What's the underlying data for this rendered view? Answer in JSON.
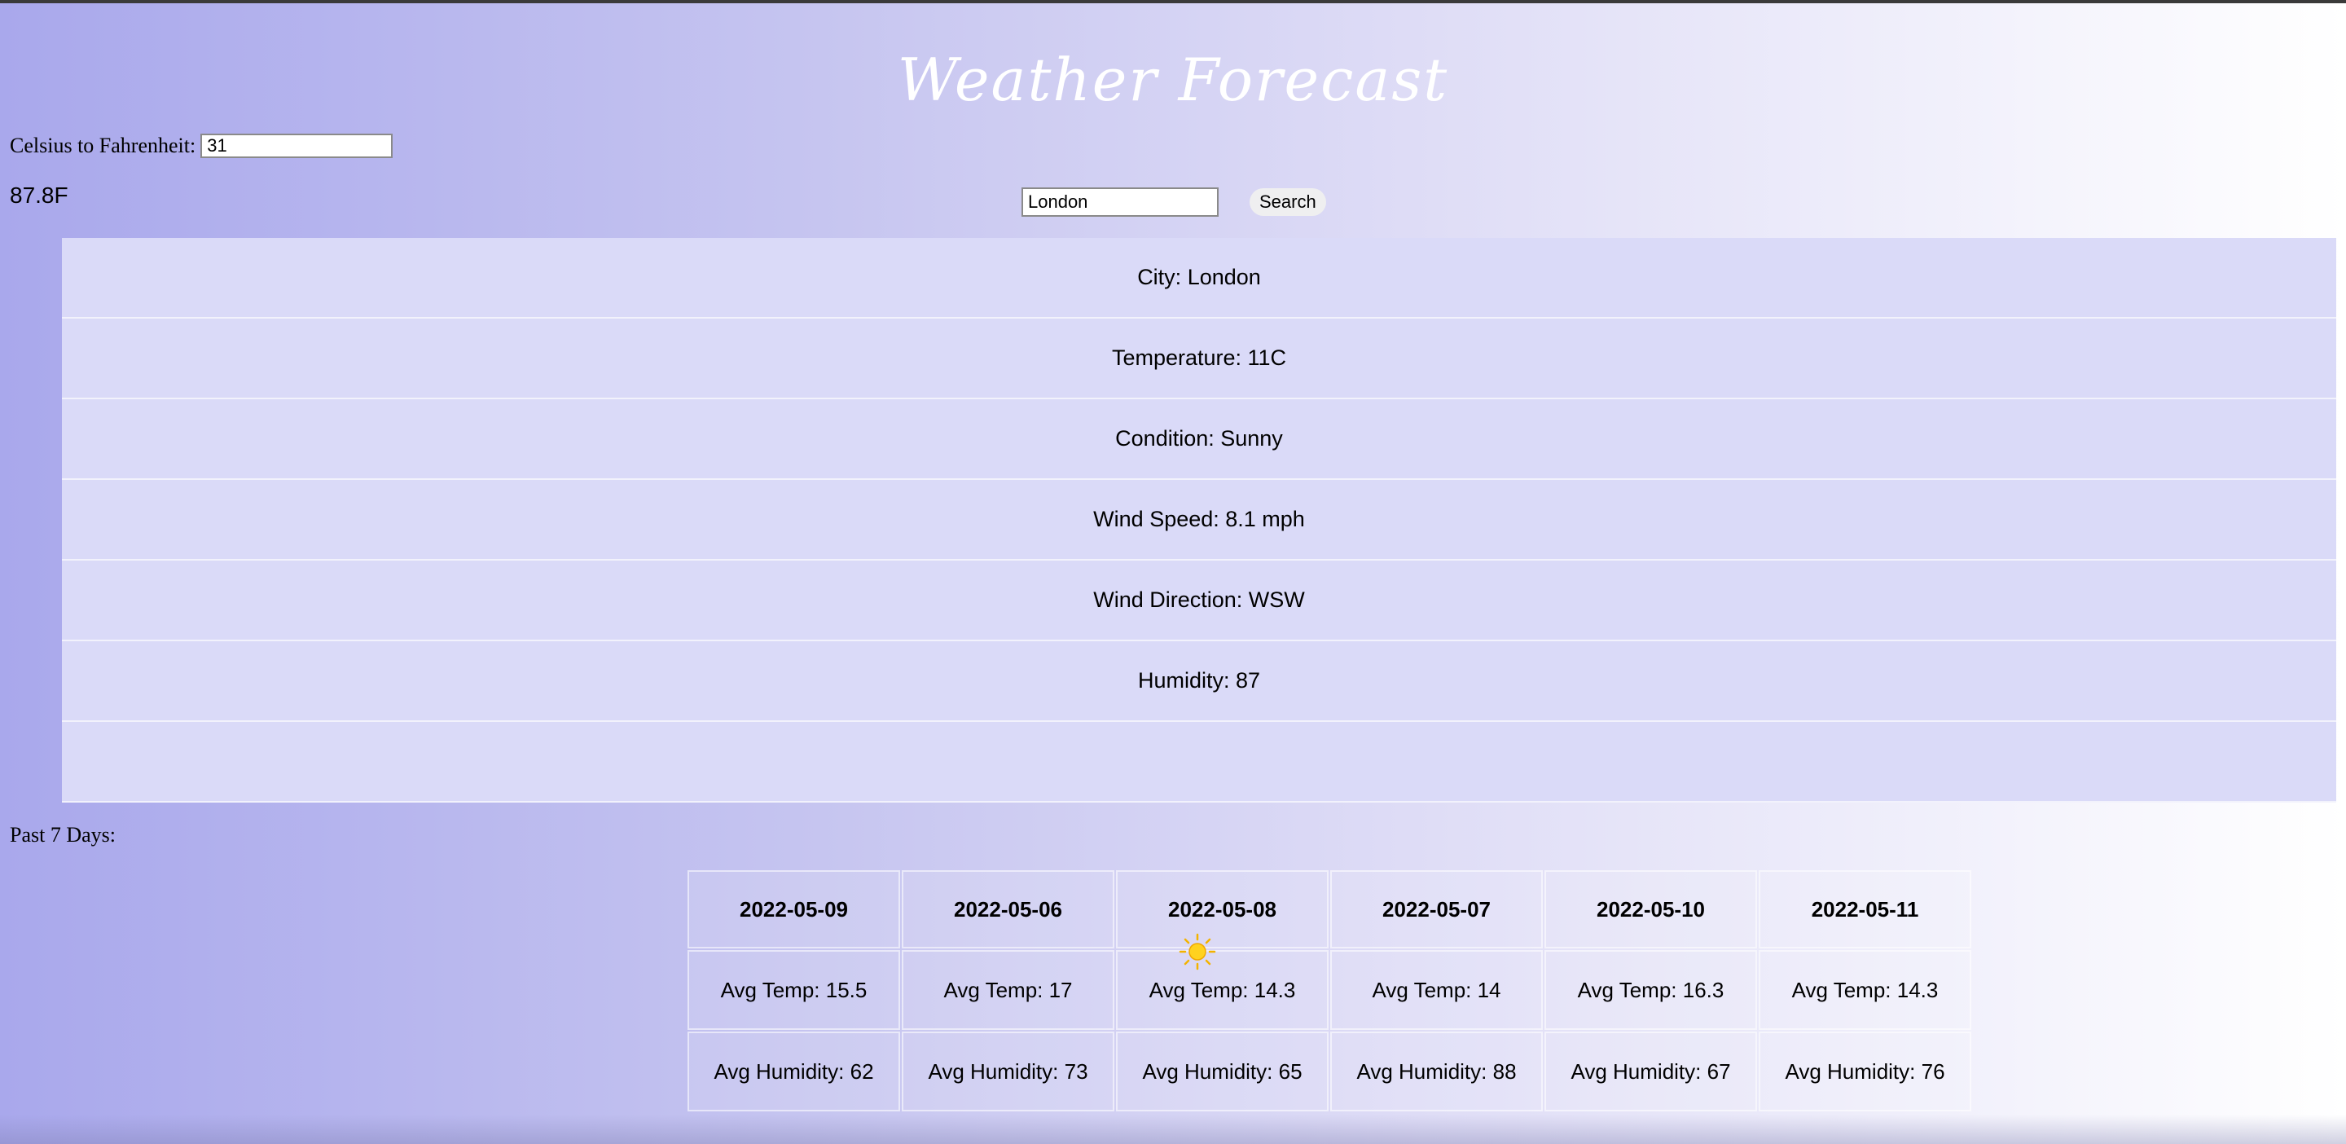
{
  "header": {
    "title": "Weather Forecast"
  },
  "converter": {
    "label": "Celsius to Fahrenheit:",
    "value": "31",
    "result": "87.8F"
  },
  "search": {
    "value": "London",
    "button_label": "Search"
  },
  "current": {
    "rows": [
      "City: London",
      "Temperature: 11C",
      "Condition: Sunny",
      "Wind Speed: 8.1 mph",
      "Wind Direction: WSW",
      "Humidity: 87",
      ""
    ]
  },
  "past": {
    "label": "Past 7 Days:",
    "days": [
      {
        "date": "2022-05-09",
        "avg_temp": "Avg Temp: 15.5",
        "avg_humidity": "Avg Humidity: 62"
      },
      {
        "date": "2022-05-06",
        "avg_temp": "Avg Temp: 17",
        "avg_humidity": "Avg Humidity: 73"
      },
      {
        "date": "2022-05-08",
        "avg_temp": "Avg Temp: 14.3",
        "avg_humidity": "Avg Humidity: 65"
      },
      {
        "date": "2022-05-07",
        "avg_temp": "Avg Temp: 14",
        "avg_humidity": "Avg Humidity: 88"
      },
      {
        "date": "2022-05-10",
        "avg_temp": "Avg Temp: 16.3",
        "avg_humidity": "Avg Humidity: 67"
      },
      {
        "date": "2022-05-11",
        "avg_temp": "Avg Temp: 14.3",
        "avg_humidity": "Avg Humidity: 76"
      }
    ]
  },
  "icons": {
    "condition_icon": "sun-icon"
  }
}
